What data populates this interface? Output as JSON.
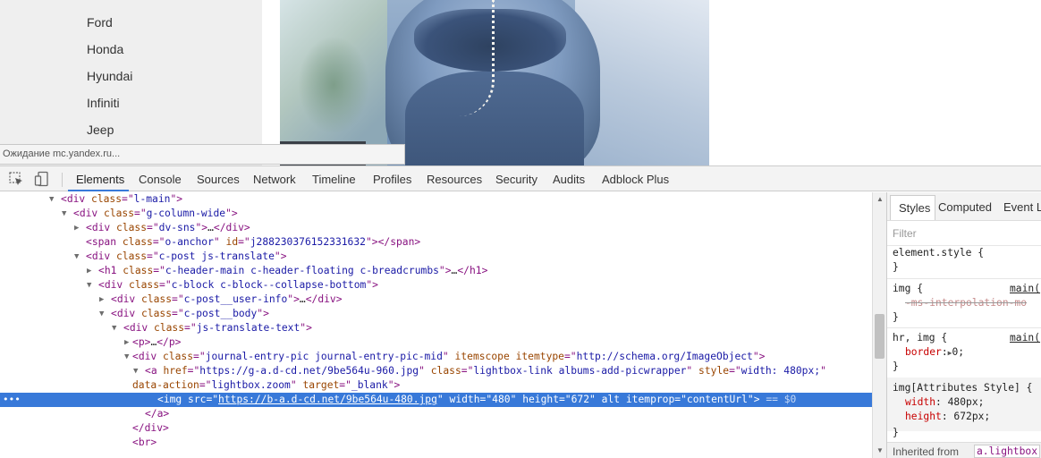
{
  "page": {
    "cars": [
      "Ford",
      "Honda",
      "Hyundai",
      "Infiniti",
      "Jeep"
    ],
    "status_text": "Ожидание mc.yandex.ru..."
  },
  "devtools": {
    "toolbar_icons": [
      "inspect-element-icon",
      "device-mode-icon"
    ],
    "tabs": [
      "Elements",
      "Console",
      "Sources",
      "Network",
      "Timeline",
      "Profiles",
      "Resources",
      "Security",
      "Audits",
      "Adblock Plus"
    ],
    "active_tab": "Elements",
    "dom": {
      "l01": {
        "tag": "div",
        "attr": "class",
        "val": "l-main"
      },
      "l02": {
        "tag": "div",
        "attr": "class",
        "val": "g-column-wide"
      },
      "l03": {
        "tag": "div",
        "attr": "class",
        "val": "dv-sns",
        "ellipsis": "…",
        "close": "div"
      },
      "l04": {
        "tag": "span",
        "attr": "class",
        "val": "o-anchor",
        "attr2": "id",
        "val2": "j288230376152331632",
        "close": "span"
      },
      "l05": {
        "tag": "div",
        "attr": "class",
        "val": "c-post js-translate"
      },
      "l06": {
        "tag": "h1",
        "attr": "class",
        "val": "c-header-main c-header-floating c-breadcrumbs",
        "ellipsis": "…",
        "close": "h1"
      },
      "l07": {
        "tag": "div",
        "attr": "class",
        "val": "c-block c-block--collapse-bottom"
      },
      "l08": {
        "tag": "div",
        "attr": "class",
        "val": "c-post__user-info",
        "ellipsis": "…",
        "close": "div"
      },
      "l09": {
        "tag": "div",
        "attr": "class",
        "val": "c-post__body"
      },
      "l10": {
        "tag": "div",
        "attr": "class",
        "val": "js-translate-text"
      },
      "l11": {
        "tag": "p",
        "ellipsis": "…",
        "close": "p"
      },
      "l12": {
        "tag": "div",
        "attr": "class",
        "val": "journal-entry-pic journal-entry-pic-mid",
        "attr2": "itemscope",
        "attr3": "itemtype",
        "val3": "http://schema.org/ImageObject"
      },
      "l13": {
        "tag": "a",
        "attr": "href",
        "val": "https://g-a.d-cd.net/9be564u-960.jpg",
        "attr2": "class",
        "val2": "lightbox-link albums-add-picwrapper",
        "attr3": "style",
        "val3": "width: 480px;"
      },
      "l14": {
        "attr": "data-action",
        "val": "lightbox.zoom",
        "attr2": "target",
        "val2": "_blank"
      },
      "l15": {
        "tag": "img",
        "attr": "src",
        "val": "https://b-a.d-cd.net/9be564u-480.jpg",
        "attr2": "width",
        "val2": "480",
        "attr3": "height",
        "val3": "672",
        "attr4": "alt",
        "attr5": "itemprop",
        "val5": "contentUrl",
        "dollar": "== $0",
        "dots": "•••"
      },
      "l16": {
        "close": "a"
      },
      "l17": {
        "close": "div"
      },
      "l18": {
        "tag": "br"
      }
    },
    "styles": {
      "tabs": [
        "Styles",
        "Computed",
        "Event L"
      ],
      "filter_placeholder": "Filter",
      "element_style": "element.style {",
      "close_brace": "}",
      "rule1_selector": "img {",
      "rule1_source": "main(",
      "rule1_prop": "-ms-interpolation-mo",
      "rule2_selector": "hr, img {",
      "rule2_source": "main(",
      "rule2_prop": "border",
      "rule2_value": "0;",
      "rule3_selector": "img[Attributes Style] {",
      "rule3_prop1": "width",
      "rule3_value1": "480px;",
      "rule3_prop2": "height",
      "rule3_value2": "672px;",
      "inherited_label": "Inherited from",
      "inherited_link": "a.lightbox"
    }
  }
}
